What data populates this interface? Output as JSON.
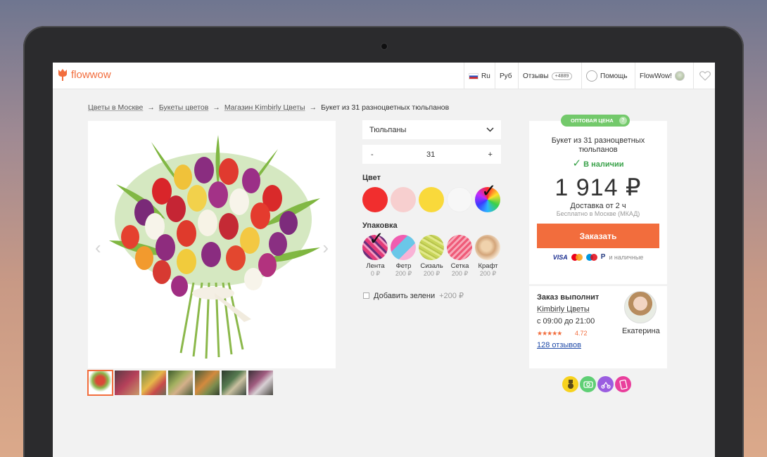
{
  "header": {
    "logo_text": "flowwow",
    "lang": "Ru",
    "currency": "Руб",
    "reviews_label": "Отзывы",
    "reviews_count": "+4889",
    "help_label": "Помощь",
    "account_label": "FlowWow!"
  },
  "breadcrumb": {
    "items": [
      "Цветы в Москве",
      "Букеты цветов",
      "Магазин Kimbirly Цветы"
    ],
    "current": "Букет из 31 разноцветных тюльпанов",
    "separator": "→"
  },
  "product": {
    "type_select": "Тюльпаны",
    "qty_minus": "-",
    "qty_value": "31",
    "qty_plus": "+",
    "color_label": "Цвет",
    "colors": [
      "#f12e2e",
      "#f7cfcf",
      "#f9d93b",
      "#f7f7f7",
      "rainbow"
    ],
    "selected_color_index": 4,
    "packaging_label": "Упаковка",
    "packaging": [
      {
        "name": "Лента",
        "price": "0 ₽"
      },
      {
        "name": "Фетр",
        "price": "200 ₽"
      },
      {
        "name": "Сизаль",
        "price": "200 ₽"
      },
      {
        "name": "Сетка",
        "price": "200 ₽"
      },
      {
        "name": "Крафт",
        "price": "200 ₽"
      }
    ],
    "greens_label": "Добавить зелени",
    "greens_price": "+200 ₽"
  },
  "buy": {
    "wholesale_badge": "ОПТОВАЯ ЦЕНА",
    "wholesale_help": "?",
    "title": "Букет из 31 разноцветных тюльпанов",
    "stock": "В наличии",
    "price": "1 914 ₽",
    "delivery": "Доставка от 2 ч",
    "delivery_sub": "Бесплатно в Москве (МКАД)",
    "order_button": "Заказать",
    "payment_visa": "VISA",
    "payment_paypal": "P",
    "payment_cash": "и наличные"
  },
  "seller": {
    "heading": "Заказ выполнит",
    "name": "Kimbirly Цветы",
    "hours": "с 09:00 до 21:00",
    "stars": "★★★★★",
    "rating": "4.72",
    "reviews": "128 отзывов",
    "florist_name": "Екатерина"
  },
  "colors": {
    "accent": "#f26d3d",
    "success": "#3aa24a",
    "wholesale": "#73c96b",
    "link": "#1f4aa8"
  }
}
